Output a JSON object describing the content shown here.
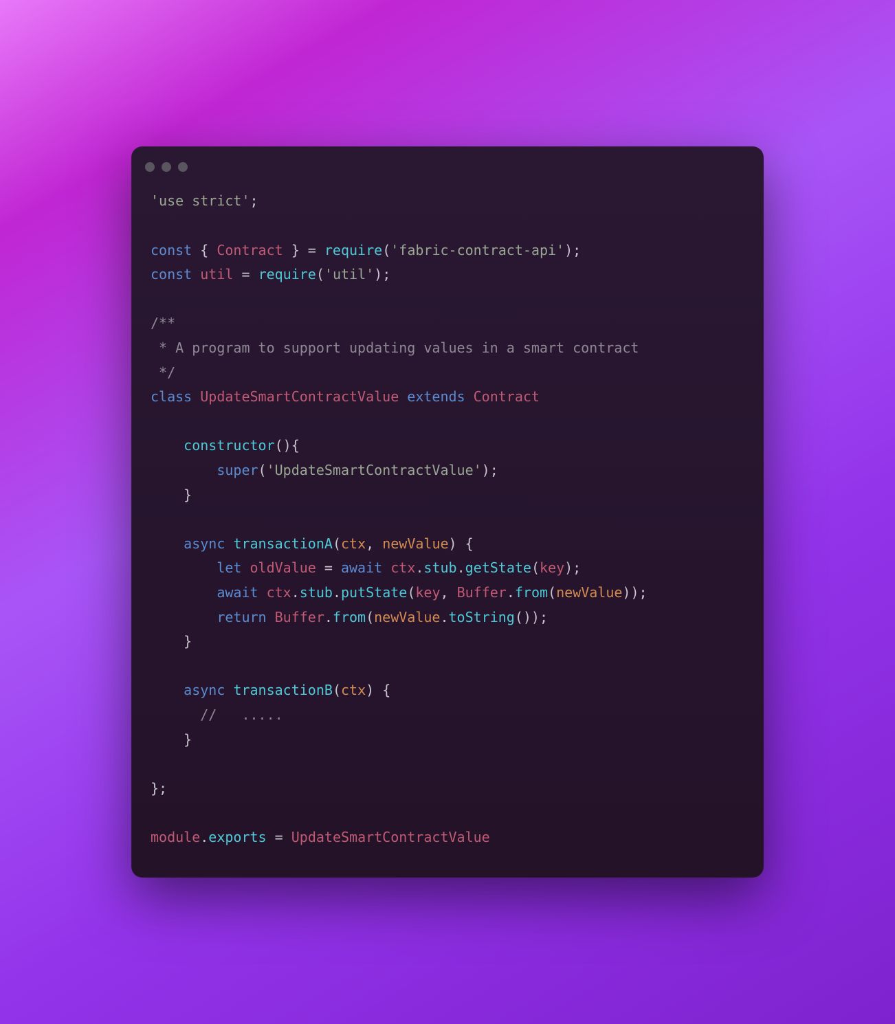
{
  "code": {
    "l01": "'use strict'",
    "l03a": "const",
    "l03b": "Contract",
    "l03c": "require",
    "l03d": "'fabric-contract-api'",
    "l04a": "const",
    "l04b": "util",
    "l04c": "require",
    "l04d": "'util'",
    "comment1": "/**",
    "comment2": " * A program to support updating values in a smart contract",
    "comment3": " */",
    "class_kw": "class",
    "class_name": "UpdateSmartContractValue",
    "extends_kw": "extends",
    "super_class": "Contract",
    "ctor": "constructor",
    "super": "super",
    "ctor_arg": "'UpdateSmartContractValue'",
    "async": "async",
    "trA": "transactionA",
    "let": "let",
    "oldValue": "oldValue",
    "await": "await",
    "ctx": "ctx",
    "newValue": "newValue",
    "stub": "stub",
    "getState": "getState",
    "putState": "putState",
    "key": "key",
    "Buffer": "Buffer",
    "from": "from",
    "return": "return",
    "toString": "toString",
    "trB": "transactionB",
    "comment_dots": "//   .....",
    "module": "module",
    "exports": "exports",
    "export_name": "UpdateSmartContractValue"
  }
}
